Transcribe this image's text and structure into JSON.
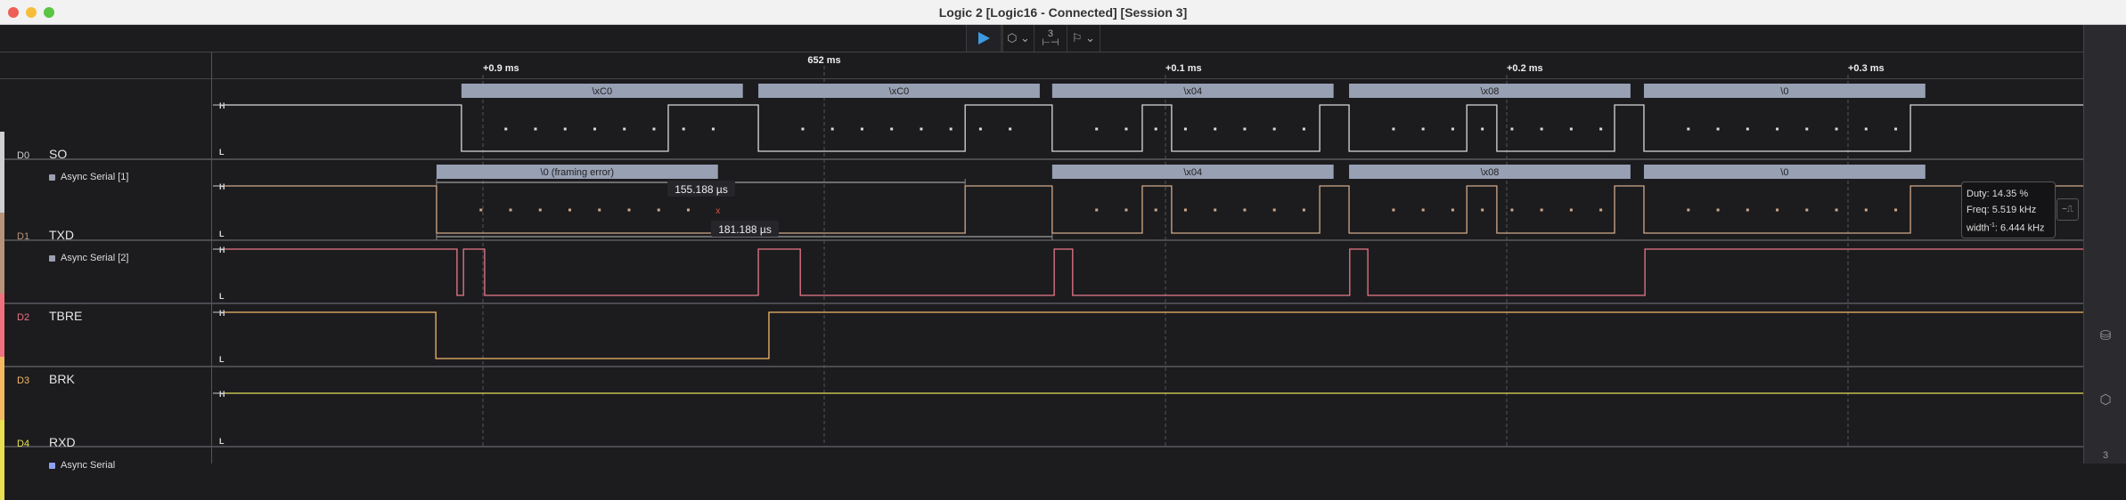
{
  "window": {
    "title": "Logic 2 [Logic16 - Connected] [Session 3]"
  },
  "toolbar": {
    "play_icon": "play-icon",
    "trigger_icon": "trigger-1f-icon",
    "measure_label": "3",
    "annotation_icon": "flag-icon",
    "accent": "#3c9be0"
  },
  "timeline": {
    "center_label": "652 ms",
    "ticks": [
      {
        "label": "+0.9 ms",
        "t_us": -100
      },
      {
        "label": "+0.1 ms",
        "t_us": 100
      },
      {
        "label": "+0.2 ms",
        "t_us": 200
      },
      {
        "label": "+0.3 ms",
        "t_us": 300
      }
    ],
    "center_t_us": 0,
    "bit_period_us": 8.68
  },
  "channels": [
    {
      "id": "D0",
      "name": "SO",
      "color": "#d8d8d8",
      "strip": "#cfcfcf",
      "analyzer": "Async Serial [1]",
      "analyzer_color": "#9aa0b0",
      "start_level": 1,
      "edges_us": [
        -106.3,
        -45.7,
        -19.3,
        41.3,
        66.8,
        93.2,
        101.8,
        145.2,
        153.8,
        188.3,
        197.1,
        231.6,
        240.2,
        318.3
      ],
      "frames": [
        {
          "label": "\\xC0",
          "start_us": -106.3
        },
        {
          "label": "\\xC0",
          "start_us": -19.3
        },
        {
          "label": "\\x04",
          "start_us": 66.8
        },
        {
          "label": "\\x08",
          "start_us": 153.8
        },
        {
          "label": "\\0",
          "start_us": 240.2
        }
      ]
    },
    {
      "id": "D1",
      "name": "TXD",
      "color": "#d0a888",
      "strip": "#b8937a",
      "analyzer": "Async Serial [2]",
      "analyzer_color": "#9aa0b0",
      "start_level": 1,
      "edges_us": [
        -113.6,
        41.3,
        66.8,
        93.2,
        101.8,
        145.2,
        153.8,
        188.3,
        197.1,
        231.6,
        240.2,
        318.3
      ],
      "frames": [
        {
          "label": "\\0 (framing error)",
          "start_us": -113.6,
          "error": true
        },
        {
          "label": "\\x04",
          "start_us": 66.8
        },
        {
          "label": "\\x08",
          "start_us": 153.8
        },
        {
          "label": "\\0",
          "start_us": 240.2
        }
      ]
    },
    {
      "id": "D2",
      "name": "TBRE",
      "color": "#e8788a",
      "strip": "#f07080",
      "start_level": 1,
      "edges_us": [
        -107.6,
        -105.7,
        -99.5,
        -19.3,
        -7.0,
        67.4,
        72.8,
        154.0,
        159.3,
        240.5
      ],
      "frames": []
    },
    {
      "id": "D3",
      "name": "BRK",
      "color": "#f3b866",
      "strip": "#f5b860",
      "start_level": 1,
      "edges_us": [
        -113.8,
        -16.2
      ],
      "frames": []
    },
    {
      "id": "D4",
      "name": "RXD",
      "color": "#e6dc5a",
      "strip": "#e8e050",
      "analyzer": "Async Serial",
      "analyzer_color": "#8ea0f0",
      "start_level": 1,
      "edges_us": [],
      "frames": []
    }
  ],
  "measurements": [
    {
      "label": "155.188 µs",
      "from_us": -113.6,
      "to_us": 41.3
    },
    {
      "label": "181.188 µs",
      "from_us": -113.6,
      "to_us": 66.8
    }
  ],
  "tooltip": {
    "duty": "Duty: 14.35 %",
    "freq": "Freq: 5.519 kHz",
    "width_prefix": "width",
    "width_sup": "-1",
    "width_value": ": 6.444 kHz"
  },
  "sidebar": {
    "items": [
      {
        "icon": "analyzers-icon"
      },
      {
        "icon": "trigger-1f-icon"
      },
      {
        "label": "3"
      }
    ]
  },
  "level_labels": {
    "high": "H",
    "low": "L"
  }
}
